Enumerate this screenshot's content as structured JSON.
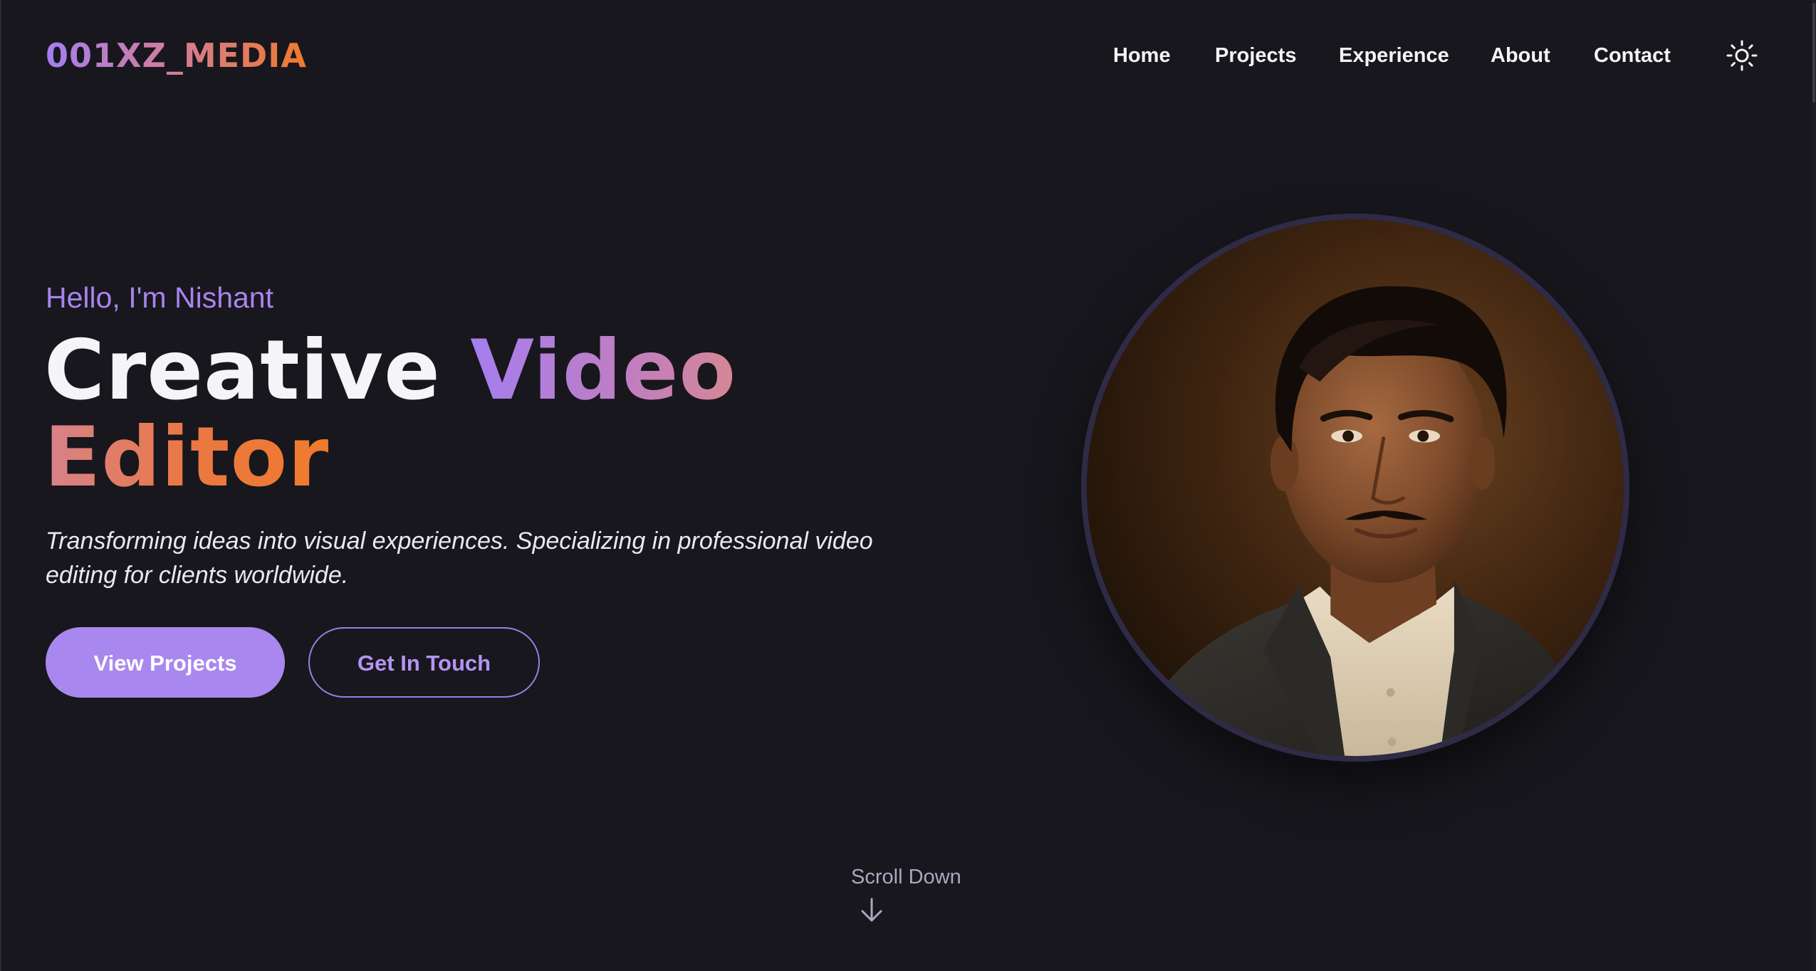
{
  "brand": {
    "logo_text": "001XZ_MEDIA"
  },
  "nav": {
    "items": [
      {
        "label": "Home"
      },
      {
        "label": "Projects"
      },
      {
        "label": "Experience"
      },
      {
        "label": "About"
      },
      {
        "label": "Contact"
      }
    ],
    "theme_toggle_icon": "sun-icon"
  },
  "hero": {
    "greeting": "Hello, I'm Nishant",
    "headline": {
      "word_1": "Creative",
      "word_2": "Video",
      "word_3": "Editor"
    },
    "tagline": "Transforming ideas into visual experiences. Specializing in professional video editing for clients worldwide.",
    "primary_button": "View Projects",
    "secondary_button": "Get In Touch",
    "scroll_label": "Scroll Down",
    "scroll_icon": "arrow-down-icon"
  },
  "colors": {
    "background": "#18171d",
    "accent_purple": "#a888ef",
    "accent_orange": "#f07a2c",
    "text_primary": "#f5f5f7"
  }
}
